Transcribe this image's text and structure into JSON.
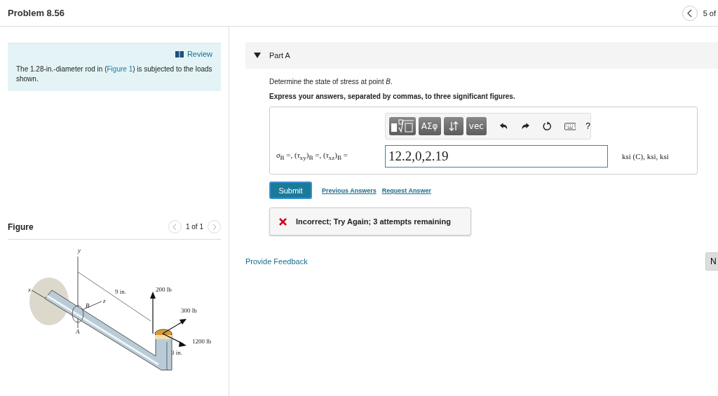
{
  "header": {
    "title": "Problem 8.56",
    "pager": "5 of"
  },
  "review": {
    "link": "Review",
    "text_before": "The 1.28-in.-diameter rod in (",
    "link_text": "Figure 1",
    "text_after": ") is subjected to the loads shown."
  },
  "figure": {
    "title": "Figure",
    "pager": "1 of 1",
    "labels": [
      "y",
      "x",
      "z",
      "B",
      "A",
      "9 in.",
      "200 lb",
      "300 lb",
      "1200 lb",
      "3 in."
    ]
  },
  "part": {
    "title": "Part A",
    "expanded": true,
    "prompt": "Determine the state of stress at point *B*.",
    "instruction": "Express your answers, separated by commas, to three significant figures.",
    "toolbar": [
      {
        "kind": "template"
      },
      {
        "kind": "text",
        "label": "ΑΣφ"
      },
      {
        "kind": "arrows"
      },
      {
        "kind": "text",
        "label": "vec"
      }
    ],
    "tools": [
      {
        "kind": "undo"
      },
      {
        "kind": "redo"
      },
      {
        "kind": "reset"
      },
      {
        "kind": "keyboard"
      },
      {
        "kind": "help",
        "label": "?"
      }
    ],
    "equation": "*σ*$_{B}$ =, (*τ*$_{xy}$)$_{B}$ =, (*τ*$_{xz}$)$_{B}$ =",
    "value": "12.2,0,2.19",
    "units": "ksi (C), ksi, ksi",
    "submit": "Submit",
    "links": [
      "Previous Answers",
      "Request Answer"
    ],
    "feedback": {
      "correct": false,
      "message": "Incorrect; Try Again; 3 attempts remaining"
    }
  },
  "provide_feedback": "Provide Feedback",
  "next_button": "N"
}
